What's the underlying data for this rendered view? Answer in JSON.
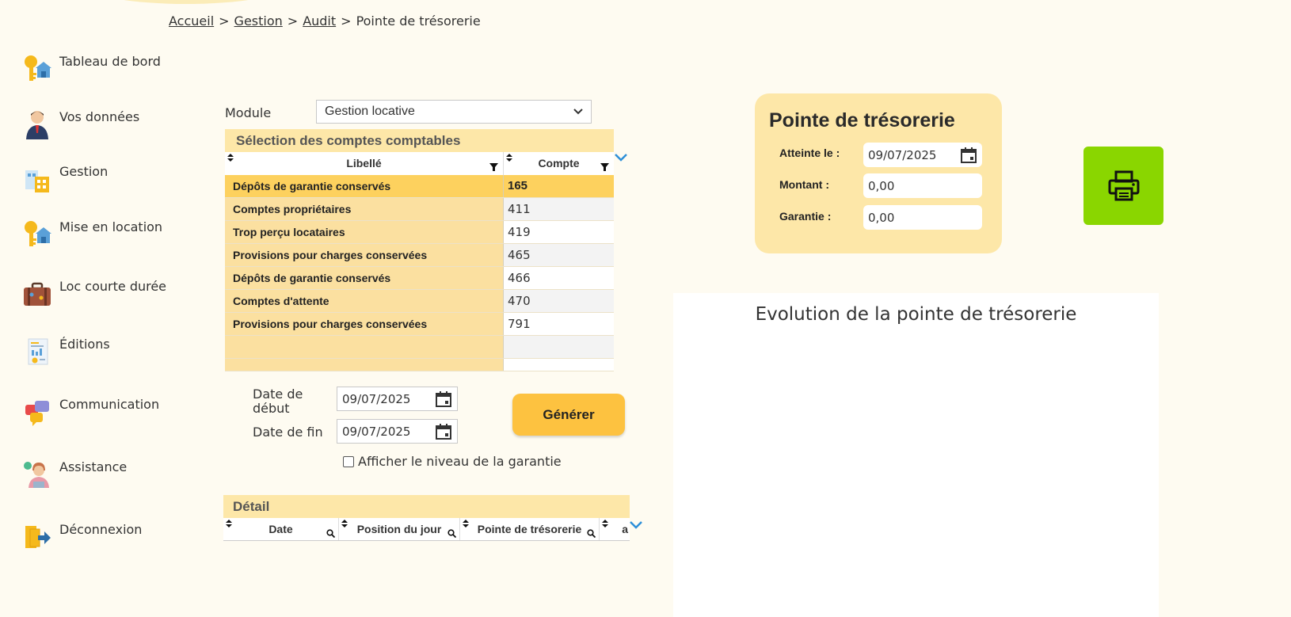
{
  "breadcrumb": {
    "items": [
      "Accueil",
      "Gestion",
      "Audit"
    ],
    "current": "Pointe de trésorerie",
    "separator": ">"
  },
  "sidebar": {
    "items": [
      {
        "label": "Tableau de bord",
        "icon": "keys-house-icon"
      },
      {
        "label": "Vos données",
        "icon": "person-icon"
      },
      {
        "label": "Gestion",
        "icon": "building-documents-icon"
      },
      {
        "label": "Mise en location",
        "icon": "keys-house-icon"
      },
      {
        "label": "Loc courte durée",
        "icon": "suitcase-icon"
      },
      {
        "label": "Éditions",
        "icon": "report-document-icon"
      },
      {
        "label": "Communication",
        "icon": "chat-bubbles-icon"
      },
      {
        "label": "Assistance",
        "icon": "support-agent-icon"
      },
      {
        "label": "Déconnexion",
        "icon": "logout-icon"
      }
    ]
  },
  "module": {
    "label": "Module",
    "selected": "Gestion locative"
  },
  "accounts": {
    "title": "Sélection des comptes comptables",
    "columns": [
      "Libellé",
      "Compte"
    ],
    "rows": [
      {
        "libelle": "Dépôts de garantie conservés",
        "compte": "165"
      },
      {
        "libelle": "Comptes propriétaires",
        "compte": "411"
      },
      {
        "libelle": "Trop perçu locataires",
        "compte": "419"
      },
      {
        "libelle": "Provisions pour charges conservées",
        "compte": "465"
      },
      {
        "libelle": "Dépôts de garantie conservés",
        "compte": "466"
      },
      {
        "libelle": "Comptes d'attente",
        "compte": "470"
      },
      {
        "libelle": "Provisions pour charges conservées",
        "compte": "791"
      }
    ]
  },
  "dates": {
    "start_label_line1": "Date de",
    "start_label_line2": "début",
    "start_value": "09/07/2025",
    "end_label": "Date de fin",
    "end_value": "09/07/2025"
  },
  "generate_label": "Générer",
  "show_guarantee_label": "Afficher le niveau de la garantie",
  "detail": {
    "title": "Détail",
    "columns": [
      "Date",
      "Position du jour",
      "Pointe de trésorerie",
      "a"
    ]
  },
  "tresorerie": {
    "title": "Pointe de trésorerie",
    "reached_label": "Atteinte le :",
    "reached_value": "09/07/2025",
    "amount_label": "Montant :",
    "amount_value": "0,00",
    "guarantee_label": "Garantie :",
    "guarantee_value": "0,00"
  },
  "chart": {
    "title": "Evolution de la pointe de trésorerie"
  },
  "colors": {
    "background": "#fefbf1",
    "panel_header": "#fde7a8",
    "selected_row": "#fdd15e",
    "generate_button": "#fdc240",
    "print_button": "#8ad600",
    "chevron": "#2d8fd8"
  }
}
